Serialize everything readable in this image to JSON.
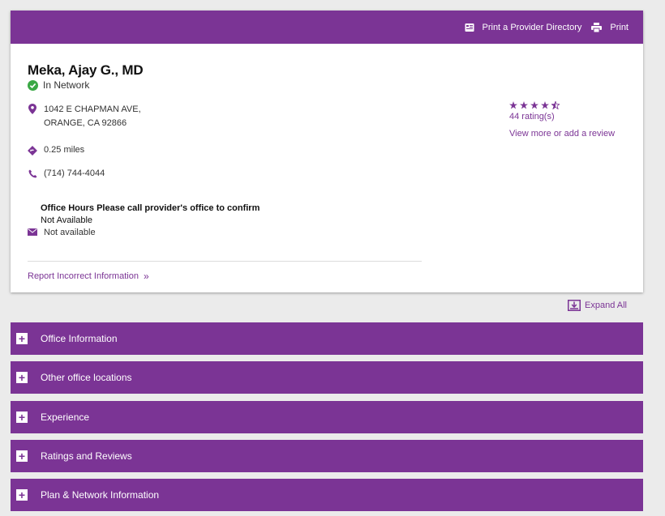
{
  "header": {
    "print_directory_label": "Print a Provider Directory",
    "print_label": "Print"
  },
  "provider": {
    "name": "Meka, Ajay G., MD",
    "network_status": "In Network",
    "address_line1": "1042 E CHAPMAN AVE,",
    "address_line2": "ORANGE, CA 92866",
    "distance": "0.25 miles",
    "phone": "(714) 744-4044",
    "office_hours_title": "Office Hours Please call provider's office to confirm",
    "office_hours_value": "Not Available",
    "email": "Not available",
    "report_link": "Report Incorrect Information"
  },
  "rating": {
    "stars": 4.5,
    "max_stars": 5,
    "count_label": "44 rating(s)",
    "review_link": "View more or add a review"
  },
  "expand_all_label": "Expand All",
  "sections": [
    {
      "label": "Office Information"
    },
    {
      "label": "Other office locations"
    },
    {
      "label": "Experience"
    },
    {
      "label": "Ratings and Reviews"
    },
    {
      "label": "Plan & Network Information"
    }
  ],
  "colors": {
    "brand_purple": "#7b3495",
    "network_green": "#3aa845",
    "background": "#ebebeb"
  },
  "icons": {
    "directory": "directory-icon",
    "print": "printer-icon",
    "network": "check-circle-icon",
    "address": "map-pin-icon",
    "distance": "directions-icon",
    "phone": "phone-icon",
    "email": "envelope-icon",
    "expand": "expand-all-icon",
    "accordion": "plus-icon"
  }
}
